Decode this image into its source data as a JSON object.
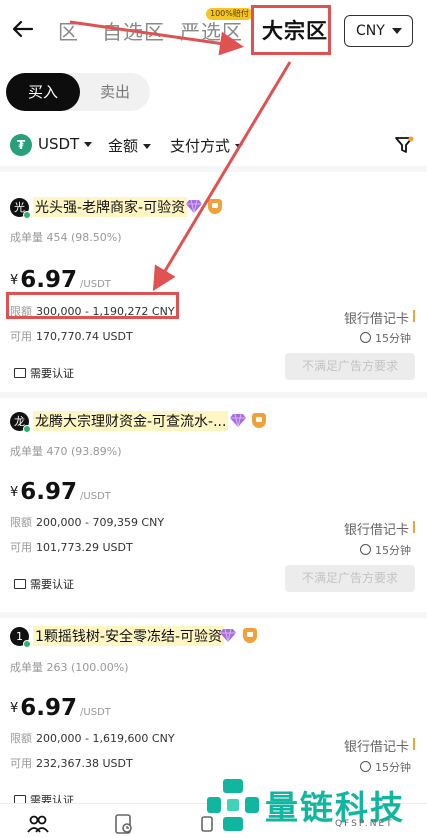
{
  "header": {
    "tab_prefix": "区",
    "tab_self_select": "自选区",
    "tab_strict": "严选区",
    "tab_strict_badge": "100%赔付",
    "tab_bulk": "大宗区",
    "currency": "CNY"
  },
  "toggle": {
    "buy": "买入",
    "sell": "卖出"
  },
  "filters": {
    "token_icon": "₮",
    "token": "USDT",
    "amount": "金额",
    "payment": "支付方式"
  },
  "ads": [
    {
      "avatar_char": "光",
      "merchant": "光头强-老牌商家-可验资",
      "orders": "成单量 454 (98.50%)",
      "currency_symbol": "¥",
      "price": "6.97",
      "unit": "/USDT",
      "limit_label": "限额",
      "limit": "300,000 - 1,190,272 CNY",
      "avail_label": "可用",
      "available": "170,770.74 USDT",
      "payment": "银行借记卡",
      "time": "15分钟",
      "kyc": "需要认证",
      "action": "不满足广告方要求"
    },
    {
      "avatar_char": "龙",
      "merchant": "龙腾大宗理财资金-可查流水-...",
      "orders": "成单量 470 (93.89%)",
      "currency_symbol": "¥",
      "price": "6.97",
      "unit": "/USDT",
      "limit_label": "限额",
      "limit": "200,000 - 709,359 CNY",
      "avail_label": "可用",
      "available": "101,773.29 USDT",
      "payment": "银行借记卡",
      "time": "15分钟",
      "kyc": "需要认证",
      "action": "不满足广告方要求"
    },
    {
      "avatar_char": "1",
      "merchant": "1颗摇钱树-安全零冻结-可验资",
      "orders": "成单量 263 (100.00%)",
      "currency_symbol": "¥",
      "price": "6.97",
      "unit": "/USDT",
      "limit_label": "限额",
      "limit": "200,000 - 1,619,600 CNY",
      "avail_label": "可用",
      "available": "232,367.38 USDT",
      "payment": "银行借记卡",
      "time": "15分钟",
      "kyc": "需要认证",
      "action": ""
    }
  ],
  "watermark": {
    "text": "量链科技",
    "sub": "QFSP.NET"
  },
  "colors": {
    "annotation_red": "#e05252",
    "tether_green": "#26a17b",
    "watermark_teal": "#10b6a0"
  }
}
